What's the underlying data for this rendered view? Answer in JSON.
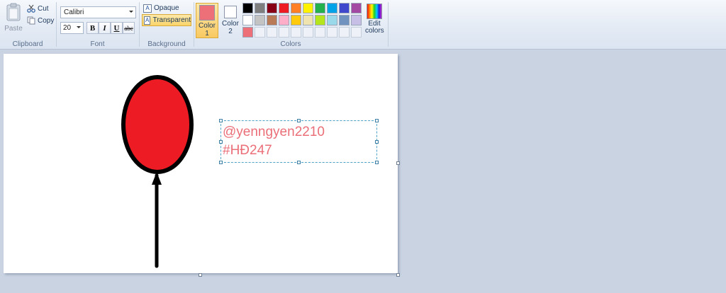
{
  "clipboard": {
    "paste_label": "Paste",
    "cut_label": "Cut",
    "copy_label": "Copy",
    "group_label": "Clipboard"
  },
  "font": {
    "family_value": "Calibri",
    "size_value": "20",
    "group_label": "Font",
    "bold_label": "B",
    "italic_label": "I",
    "underline_label": "U",
    "strike_label": "abc"
  },
  "background": {
    "opaque_label": "Opaque",
    "transparent_label": "Transparent",
    "selected": "Transparent",
    "group_label": "Background"
  },
  "colors": {
    "color1_label_line1": "Color",
    "color1_label_line2": "1",
    "color2_label_line1": "Color",
    "color2_label_line2": "2",
    "color1_value": "#ed6f78",
    "color2_value": "#ffffff",
    "edit_label_line1": "Edit",
    "edit_label_line2": "colors",
    "group_label": "Colors",
    "palette_row1": [
      "#000000",
      "#7f7f7f",
      "#880015",
      "#ed1c24",
      "#ff7f27",
      "#fff200",
      "#22b14c",
      "#00a2e8",
      "#3f48cc",
      "#a349a4"
    ],
    "palette_row2": [
      "#ffffff",
      "#c3c3c3",
      "#b97a57",
      "#ffaec9",
      "#ffc90e",
      "#efe4b0",
      "#b5e61d",
      "#99d9ea",
      "#7092be",
      "#c8bfe7"
    ],
    "palette_row3": [
      "#ed6f78",
      "",
      "",
      "",
      "",
      "",
      "",
      "",
      "",
      ""
    ]
  },
  "canvas": {
    "text_line1": "@yenngyen2210",
    "text_line2": "#HĐ247",
    "balloon_fill": "#ed1c24",
    "outline_color": "#000000"
  }
}
